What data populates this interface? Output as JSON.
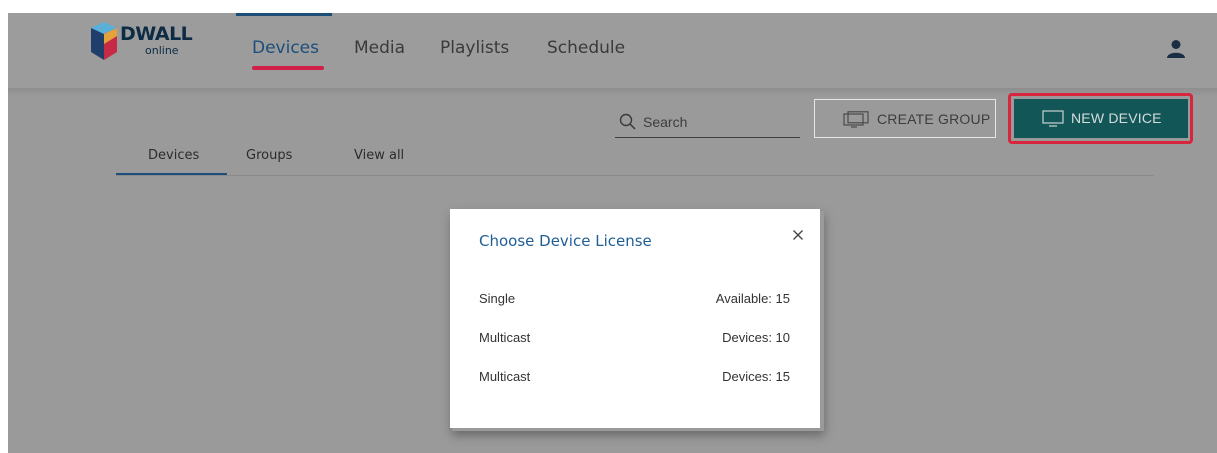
{
  "brand": {
    "name": "DWALL",
    "subtitle": "online"
  },
  "nav": {
    "items": [
      {
        "label": "Devices",
        "active": true
      },
      {
        "label": "Media"
      },
      {
        "label": "Playlists"
      },
      {
        "label": "Schedule"
      }
    ]
  },
  "icons": {
    "user": "user-icon",
    "search": "search-icon",
    "group": "monitor-group-icon",
    "device": "monitor-icon",
    "close": "close-icon"
  },
  "toolbar": {
    "search_placeholder": "Search",
    "create_group_label": "CREATE GROUP",
    "new_device_label": "NEW DEVICE"
  },
  "subtabs": [
    {
      "label": "Devices",
      "active": true
    },
    {
      "label": "Groups"
    },
    {
      "label": "View all"
    }
  ],
  "modal": {
    "title": "Choose Device License",
    "close_symbol": "×",
    "licenses": [
      {
        "type": "Single",
        "info": "Available: 15"
      },
      {
        "type": "Multicast",
        "info": "Devices: 10"
      },
      {
        "type": "Multicast",
        "info": "Devices: 15"
      }
    ]
  },
  "colors": {
    "accent": "#135657",
    "highlight": "#d8263e",
    "nav_active": "#1d4e7a",
    "title": "#1f5e96"
  }
}
